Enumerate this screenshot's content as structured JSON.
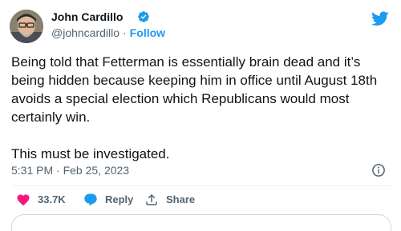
{
  "author": {
    "name": "John Cardillo",
    "handle": "@johncardillo",
    "follow_label": "Follow",
    "separator": "·"
  },
  "tweet": {
    "text": "Being told that Fetterman is essentially brain dead and it’s being hidden because keeping him in office until August 18th avoids a special election which Republicans would most certainly win.\n\nThis must be investigated.",
    "timestamp": "5:31 PM · Feb 25, 2023"
  },
  "actions": {
    "like_count": "33.7K",
    "reply_label": "Reply",
    "share_label": "Share"
  },
  "colors": {
    "accent": "#1d9bf0",
    "like": "#f91880",
    "muted": "#536471"
  },
  "icons": [
    "verified-badge-icon",
    "twitter-bird-icon",
    "info-icon",
    "heart-icon",
    "reply-bubble-icon",
    "share-icon"
  ]
}
